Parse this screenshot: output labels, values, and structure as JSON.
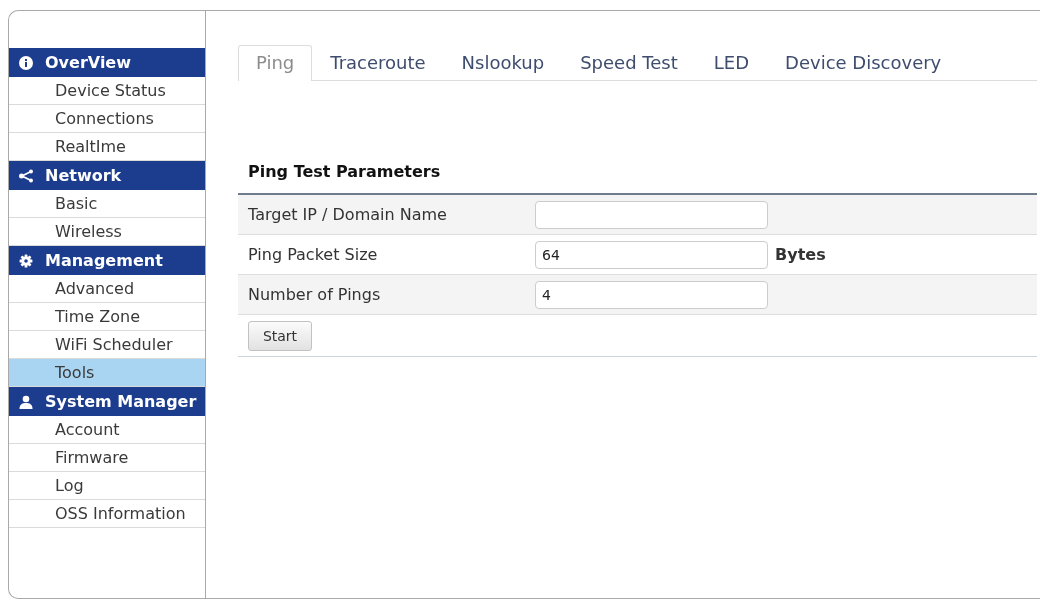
{
  "sidebar": {
    "sections": [
      {
        "title": "OverView",
        "items": [
          {
            "label": "Device Status",
            "selected": false
          },
          {
            "label": "Connections",
            "selected": false
          },
          {
            "label": "RealtIme",
            "selected": false
          }
        ]
      },
      {
        "title": "Network",
        "items": [
          {
            "label": "Basic",
            "selected": false
          },
          {
            "label": "Wireless",
            "selected": false
          }
        ]
      },
      {
        "title": "Management",
        "items": [
          {
            "label": "Advanced",
            "selected": false
          },
          {
            "label": "Time Zone",
            "selected": false
          },
          {
            "label": "WiFi Scheduler",
            "selected": false
          },
          {
            "label": "Tools",
            "selected": true
          }
        ]
      },
      {
        "title": "System Manager",
        "items": [
          {
            "label": "Account",
            "selected": false
          },
          {
            "label": "Firmware",
            "selected": false
          },
          {
            "label": "Log",
            "selected": false
          },
          {
            "label": "OSS Information",
            "selected": false
          }
        ]
      }
    ]
  },
  "tabs": [
    {
      "label": "Ping",
      "selected": true
    },
    {
      "label": "Traceroute",
      "selected": false
    },
    {
      "label": "Nslookup",
      "selected": false
    },
    {
      "label": "Speed Test",
      "selected": false
    },
    {
      "label": "LED",
      "selected": false
    },
    {
      "label": "Device Discovery",
      "selected": false
    }
  ],
  "ping_test": {
    "title": "Ping Test Parameters",
    "fields": [
      {
        "label": "Target IP / Domain Name"
      },
      {
        "label": "Ping Packet Size",
        "value": "64",
        "unit": "Bytes"
      },
      {
        "label": "Number of Pings",
        "value": "4"
      }
    ],
    "button": "Start"
  }
}
